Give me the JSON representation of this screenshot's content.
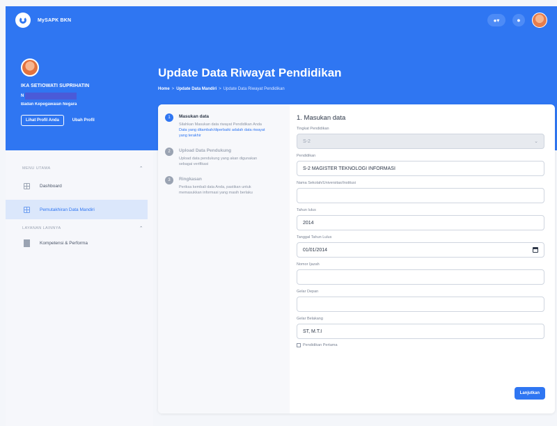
{
  "app": {
    "title": "MySAPK BKN"
  },
  "profile": {
    "name": "IKA SETIOWATI SUPRIHATIN",
    "nip_prefix": "N",
    "agency": "Badan Kepegawaian Negara",
    "view_profile_label": "Lihat Profil Anda",
    "edit_profile_label": "Ubah Profil"
  },
  "page": {
    "title": "Update Data Riwayat Pendidikan",
    "breadcrumb": [
      "Home",
      ">",
      "Update Data Mandiri",
      ">",
      "Update Data Riwayat Pendidikan"
    ]
  },
  "sidebar": {
    "sections": [
      {
        "title": "MENU UTAMA",
        "items": [
          {
            "label": "Dashboard"
          },
          {
            "label": "Pemutakhiran Data Mandiri"
          }
        ]
      },
      {
        "title": "LAYANAN LAINNYA",
        "items": [
          {
            "label": "Kompetensi & Performa"
          }
        ]
      }
    ]
  },
  "steps": [
    {
      "num": "1",
      "title": "Masukan data",
      "desc": "Silahkan Masukan data riwayat Pendidikan Anda",
      "note": "Data yang ditambah/diperbaiki adalah data riwayat yang terakhir"
    },
    {
      "num": "2",
      "title": "Upload Data Pendukung",
      "desc": "Upload data pendukung yang akan digunakan sebagai verifikasi"
    },
    {
      "num": "3",
      "title": "Ringkasan",
      "desc": "Periksa kembali data Anda, pastikan untuk memasukkan informasi yang masih berlaku"
    }
  ],
  "form": {
    "title": "1. Masukan data",
    "fields": {
      "tingkat": {
        "label": "Tingkat Pendidikan",
        "value": "S-2"
      },
      "pendidikan": {
        "label": "Pendidikan",
        "value": "S-2 MAGISTER TEKNOLOGI INFORMASI"
      },
      "sekolah": {
        "label": "Nama Sekolah/Universitas/Institusi",
        "value": ""
      },
      "tahun": {
        "label": "Tahun lulus",
        "value": "2014"
      },
      "tanggal": {
        "label": "Tanggal Tahun Lulus",
        "value": "01/01/2014"
      },
      "ijazah": {
        "label": "Nomor Ijazah",
        "value": ""
      },
      "gelar_depan": {
        "label": "Gelar Depan",
        "value": ""
      },
      "gelar_belakang": {
        "label": "Gelar Belakang",
        "value": "ST, M.T.I"
      }
    },
    "first_education_label": "Pendidikan Pertama",
    "submit_label": "Lanjutkan"
  },
  "colors": {
    "primary": "#2f76f2",
    "nip_redaction": "#4a5ad8"
  }
}
